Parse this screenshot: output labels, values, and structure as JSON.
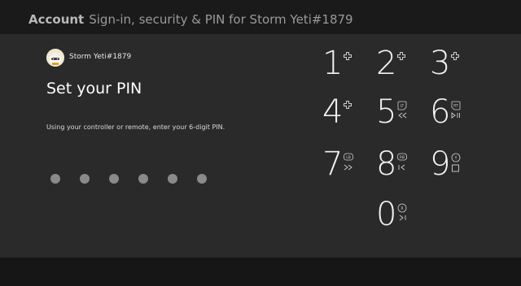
{
  "header": {
    "section": "Account",
    "title": "Sign-in, security & PIN for Storm Yeti#1879"
  },
  "user": {
    "gamertag": "Storm Yeti#1879"
  },
  "pin": {
    "heading": "Set your PIN",
    "instruction": "Using your controller or remote, enter your 6-digit PIN.",
    "digits_total": 6,
    "digits_entered": 0
  },
  "keypad": {
    "keys": [
      {
        "digit": "1",
        "hint_icon": "dpad-icon",
        "hint_icon2": ""
      },
      {
        "digit": "2",
        "hint_icon": "dpad-icon",
        "hint_icon2": ""
      },
      {
        "digit": "3",
        "hint_icon": "dpad-icon",
        "hint_icon2": ""
      },
      {
        "digit": "4",
        "hint_icon": "dpad-icon",
        "hint_icon2": ""
      },
      {
        "digit": "5",
        "hint_label": "LT",
        "hint_icon2": "rewind-icon"
      },
      {
        "digit": "6",
        "hint_label": "RT",
        "hint_icon2": "play-pause-icon"
      },
      {
        "digit": "7",
        "hint_label": "LB",
        "hint_icon2": "fast-forward-icon"
      },
      {
        "digit": "8",
        "hint_label": "RB",
        "hint_icon2": "skip-back-icon"
      },
      {
        "digit": "9",
        "hint_label": "Y",
        "hint_icon2": "stop-icon"
      },
      {
        "digit": "0",
        "hint_label": "X",
        "hint_icon2": "skip-forward-icon"
      }
    ]
  },
  "colors": {
    "background": "#2a2a2a",
    "header": "#1a1a1a",
    "text": "#ffffff",
    "pin_dot": "#8a8a8a"
  }
}
